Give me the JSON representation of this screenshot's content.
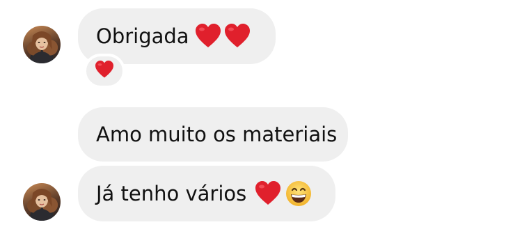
{
  "messages": [
    {
      "text": "Obrigada",
      "emojis": [
        "heart-emoji",
        "heart-emoji"
      ]
    },
    {
      "text": "Amo muito os materiais",
      "emojis": []
    },
    {
      "text": "Já tenho vários",
      "emojis": [
        "heart-emoji",
        "grinning-face-emoji"
      ]
    }
  ],
  "reaction": {
    "emoji": "heart-emoji"
  },
  "colors": {
    "bubble_bg": "#efefef",
    "text": "#111111",
    "heart": "#e0202c",
    "smiley": "#f7c23a"
  }
}
